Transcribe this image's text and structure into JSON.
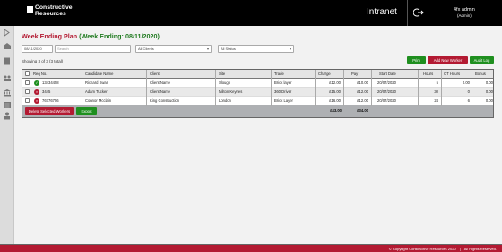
{
  "brand": {
    "line1": "Constructive",
    "line2": "Resources",
    "app": "Intranet"
  },
  "user": {
    "name": "4fx admin",
    "role": "(Admin)"
  },
  "page": {
    "title": "Week Ending Plan",
    "week": "(Week Ending: 08/11/2020)"
  },
  "filters": {
    "date": "08/11/2020",
    "search_placeholder": "Search",
    "clients": "All Clients",
    "status": "All Status"
  },
  "buttons": {
    "print": "Print",
    "add_worker": "Add New Worker",
    "audit": "Audit Log",
    "delete": "Delete Selected Workers",
    "export": "Export"
  },
  "summary": {
    "showing": "Showing 3 of 3 (3 total)"
  },
  "table": {
    "columns": [
      "Req No.",
      "Candidate Name",
      "Client",
      "Site",
      "Trade",
      "Charge",
      "Pay",
      "Start Date",
      "Hours",
      "OT Hours",
      "Bonus"
    ],
    "rows": [
      {
        "status": "ok",
        "req": "13434458",
        "candidate": "Richard Swan",
        "client": "Client Name",
        "site": "Slough",
        "trade": "Brick layer",
        "charge": "£12.00",
        "pay": "£10.00",
        "start": "20/07/2020",
        "hours": "5",
        "ot": "0.00",
        "bonus": "0.00"
      },
      {
        "status": "bad",
        "req": "3445",
        "candidate": "Adam Tucker",
        "client": "Client Name",
        "site": "Milton Keynes",
        "trade": "360 Driver",
        "charge": "£15.00",
        "pay": "£12.00",
        "start": "20/07/2020",
        "hours": "30",
        "ot": "0",
        "bonus": "0.00"
      },
      {
        "status": "bad",
        "req": "76776756",
        "candidate": "Connor Mcclain",
        "client": "King Construction",
        "site": "London",
        "trade": "Brick Layer",
        "charge": "£16.00",
        "pay": "£12.00",
        "start": "20/07/2020",
        "hours": "24",
        "ot": "6",
        "bonus": "0.00"
      }
    ],
    "totals": {
      "charge": "£43.00",
      "pay": "£34.00"
    }
  },
  "footer": {
    "copyright": "© Copyright Constructive Resources 2020",
    "separator": "|",
    "rights": "All Rights Reserved."
  },
  "colors": {
    "accent": "#b31a32",
    "success": "#1f8f1f",
    "topbar": "#000000"
  },
  "icons": [
    "logo-icon",
    "logout-icon",
    "menu-toggle-icon",
    "home-icon",
    "document-icon",
    "people-icon",
    "bank-icon",
    "list-icon",
    "user-icon",
    "status-check-icon",
    "status-cross-icon"
  ]
}
